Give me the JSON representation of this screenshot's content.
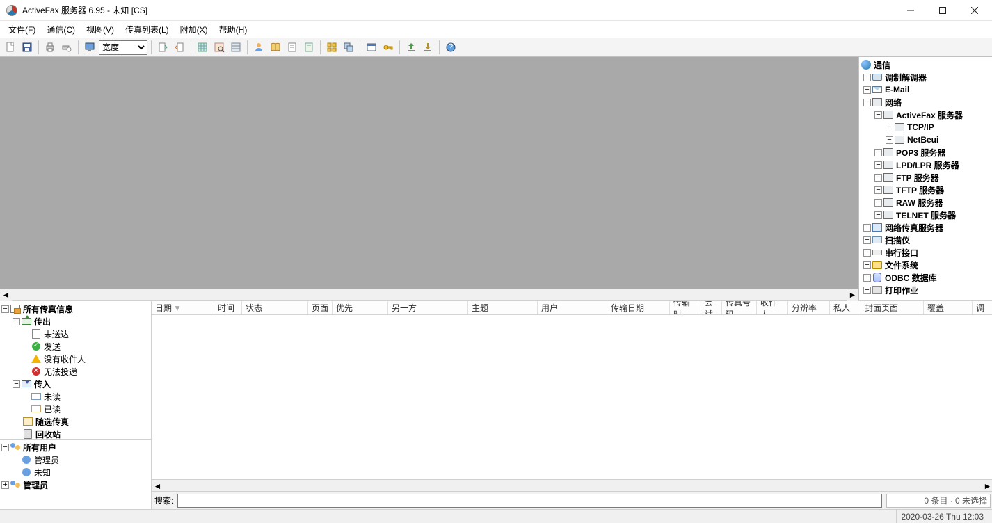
{
  "window": {
    "title": "ActiveFax 服务器 6.95 - 未知  [CS]"
  },
  "menu": {
    "file": "文件(F)",
    "comm": "通信(C)",
    "view": "视图(V)",
    "faxlist": "传真列表(L)",
    "addon": "附加(X)",
    "help": "帮助(H)"
  },
  "toolbar": {
    "zoom_selected": "宽度"
  },
  "right_tree": {
    "root": "通信",
    "items": [
      {
        "label": "调制解调器",
        "icon": "modem"
      },
      {
        "label": "E-Mail",
        "icon": "mail"
      },
      {
        "label": "网络",
        "icon": "net",
        "expanded": true,
        "children": [
          {
            "label": "ActiveFax 服务器",
            "icon": "srv",
            "expanded": true,
            "children": [
              {
                "label": "TCP/IP",
                "icon": "srv"
              },
              {
                "label": "NetBeui",
                "icon": "srv"
              }
            ]
          },
          {
            "label": "POP3 服务器",
            "icon": "srv"
          },
          {
            "label": "LPD/LPR 服务器",
            "icon": "srv"
          },
          {
            "label": "FTP 服务器",
            "icon": "srv"
          },
          {
            "label": "TFTP 服务器",
            "icon": "srv"
          },
          {
            "label": "RAW 服务器",
            "icon": "srv"
          },
          {
            "label": "TELNET 服务器",
            "icon": "srv"
          }
        ]
      },
      {
        "label": "网络传真服务器",
        "icon": "faxsrv"
      },
      {
        "label": "扫描仪",
        "icon": "scanner"
      },
      {
        "label": "串行接口",
        "icon": "serial"
      },
      {
        "label": "文件系统",
        "icon": "folder"
      },
      {
        "label": "ODBC 数据库",
        "icon": "db"
      },
      {
        "label": "打印作业",
        "icon": "printer"
      }
    ]
  },
  "left_tree_fax": {
    "root": "所有传真信息",
    "outgoing": "传出",
    "out_items": {
      "unsent": "未送达",
      "sent": "发送",
      "norecip": "没有收件人",
      "undeliv": "无法投递"
    },
    "incoming": "传入",
    "in_items": {
      "unread": "未读",
      "read": "已读"
    },
    "random": "随选传真",
    "trash": "回收站"
  },
  "left_tree_users": {
    "root": "所有用户",
    "admin": "管理员",
    "unknown": "未知",
    "admin2": "管理员"
  },
  "list": {
    "columns": [
      "日期",
      "时间",
      "状态",
      "页面",
      "优先",
      "另一方",
      "主题",
      "用户",
      "传输日期",
      "传输时",
      "尝试",
      "传真号码",
      "收件人",
      "分辨率",
      "私人",
      "封面页面",
      "覆盖",
      "调"
    ],
    "search_label": "搜索:",
    "count_text": "0 条目 · 0 未选择"
  },
  "status": {
    "datetime": "2020-03-26 Thu   12:03"
  }
}
